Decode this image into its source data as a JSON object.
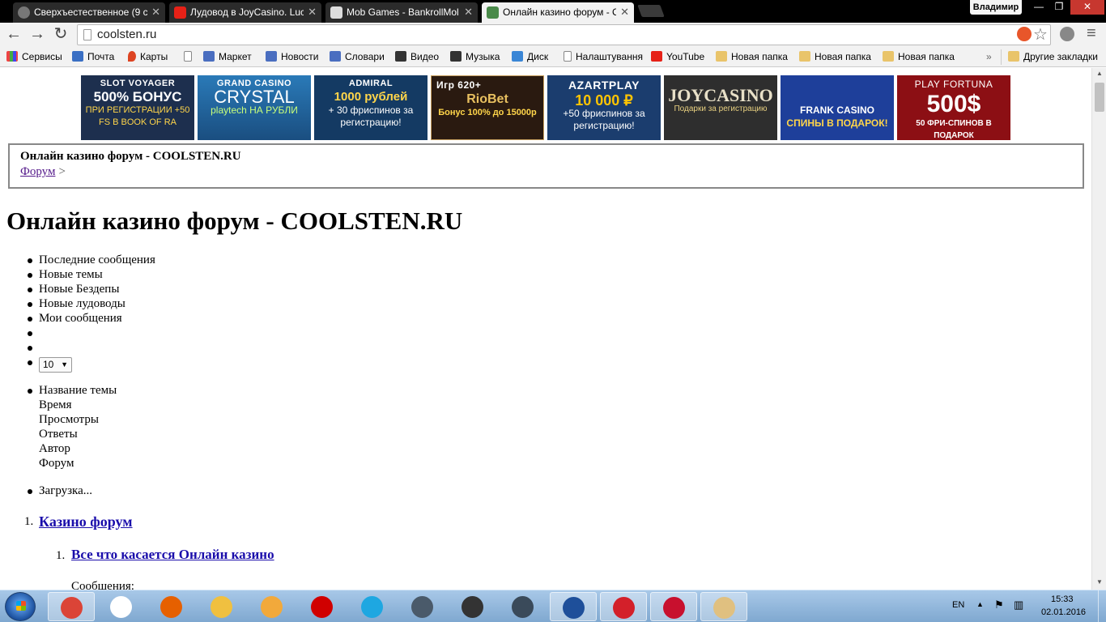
{
  "browser": {
    "tabs": [
      {
        "title": "Сверхъестественное (9 се",
        "close": "✕",
        "favicon_color": "#888888"
      },
      {
        "title": "Лудовод в JoyCasino. Luc",
        "close": "✕",
        "favicon_color": "#e62117"
      },
      {
        "title": "Mob Games - BankrollMol",
        "close": "✕",
        "favicon_color": "#dddddd"
      },
      {
        "title": "Онлайн казино форум - C",
        "close": "✕",
        "favicon_color": "#4a8a4a"
      }
    ],
    "user_name": "Владимир",
    "window_controls": {
      "minimize": "—",
      "maximize": "❐",
      "close": "✕"
    },
    "nav": {
      "back": "←",
      "forward": "→",
      "reload": "↻"
    },
    "address": "coolsten.ru",
    "star_icon": "☆",
    "menu_icon": "≡"
  },
  "bookmarks": [
    {
      "label": "Сервисы",
      "icon": "apps-icon"
    },
    {
      "label": "Почта",
      "icon": "mail-icon"
    },
    {
      "label": "Карты",
      "icon": "maps-icon"
    },
    {
      "label": "",
      "icon": "page-icon"
    },
    {
      "label": "Маркет",
      "icon": "market-icon"
    },
    {
      "label": "Новости",
      "icon": "news-icon"
    },
    {
      "label": "Словари",
      "icon": "dict-icon"
    },
    {
      "label": "Видео",
      "icon": "video-icon"
    },
    {
      "label": "Музыка",
      "icon": "music-icon"
    },
    {
      "label": "Диск",
      "icon": "disk-icon"
    },
    {
      "label": "Налаштування",
      "icon": "page-icon"
    },
    {
      "label": "YouTube",
      "icon": "youtube-icon"
    },
    {
      "label": "Новая папка",
      "icon": "folder-icon"
    },
    {
      "label": "Новая папка",
      "icon": "folder-icon"
    },
    {
      "label": "Новая папка",
      "icon": "folder-icon"
    }
  ],
  "bookmarks_more": "»",
  "bookmarks_other": "Другие закладки",
  "banners": [
    {
      "line1": "SLOT VOYAGER",
      "line2": "500% БОНУС",
      "line3": "ПРИ РЕГИСТРАЦИИ +50 FS В BOOK OF RA",
      "bg": "#1d2f4e"
    },
    {
      "line1": "GRAND CASINO",
      "line2": "CRYSTAL",
      "line3": "playtech НА РУБЛИ",
      "bg": "#1f6fa8"
    },
    {
      "line1": "ADMIRAL",
      "line2": "1000 рублей",
      "line3": "+ 30 фриспинов за регистрацию!",
      "bg": "#143a63"
    },
    {
      "line1": "Игр 620+",
      "line2": "RioBet",
      "line3": "Бонус 100% до 15000р",
      "bg": "#2a1a10"
    },
    {
      "line1": "AZARTPLAY",
      "line2": "10 000 ₽",
      "line3": "+50 фриспинов за регистрацию!",
      "bg": "#1b3d6e"
    },
    {
      "line1": "",
      "line2": "JOYCASINO",
      "line3": "Подарки за регистрацию",
      "bg": "#2e2e2e"
    },
    {
      "line1": "",
      "line2": "FRANK CASINO",
      "line3": "СПИНЫ В ПОДАРОК!",
      "bg": "#1e3f9a"
    },
    {
      "line1": "PLAY FORTUNA",
      "line2": "500$",
      "line3": "50 ФРИ-СПИНОВ В ПОДАРОК",
      "bg": "#8c0f14"
    }
  ],
  "page": {
    "crumb_title": "Онлайн казино форум - COOLSTEN.RU",
    "crumb_link": "Форум",
    "crumb_sep": ">",
    "heading": "Онлайн казино форум - COOLSTEN.RU",
    "nav_list": [
      "Последние сообщения",
      "Новые темы",
      "Новые Бездепы",
      "Новые лудоводы",
      "Мои сообщения"
    ],
    "per_page": "10",
    "sort_fields": [
      "Название темы",
      "Время",
      "Просмотры",
      "Ответы",
      "Автор",
      "Форум"
    ],
    "loading": "Загрузка...",
    "category_num": "1.",
    "category": "Казино форум",
    "forum_num": "1.",
    "forum": "Все что касается Онлайн казино",
    "messages_label": "Сообщения:"
  },
  "taskbar": {
    "apps": [
      {
        "name": "chrome",
        "color": "#db4437",
        "active": true
      },
      {
        "name": "yandex",
        "color": "#ffffff",
        "active": false
      },
      {
        "name": "firefox",
        "color": "#e66000",
        "active": false
      },
      {
        "name": "explorer",
        "color": "#f0c040",
        "active": false
      },
      {
        "name": "media-player",
        "color": "#f2a93b",
        "active": false
      },
      {
        "name": "opera",
        "color": "#d00000",
        "active": false
      },
      {
        "name": "ie",
        "color": "#1ea7e1",
        "active": false
      },
      {
        "name": "world-of-warplanes",
        "color": "#4a5a6a",
        "active": false
      },
      {
        "name": "world-of-tanks",
        "color": "#333333",
        "active": false
      },
      {
        "name": "world-of-warships",
        "color": "#3a4a5a",
        "active": false
      },
      {
        "name": "poker-app",
        "color": "#1e4f9a",
        "active": true
      },
      {
        "name": "star-app",
        "color": "#d3202a",
        "active": true
      },
      {
        "name": "pokerstars",
        "color": "#c8102e",
        "active": true
      },
      {
        "name": "paint",
        "color": "#e0c080",
        "active": true
      }
    ],
    "lang": "EN",
    "time": "15:33",
    "date": "02.01.2016"
  }
}
